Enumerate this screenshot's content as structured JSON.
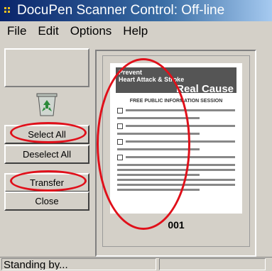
{
  "window": {
    "title": "DocuPen Scanner Control: Off-line"
  },
  "menu": {
    "items": [
      "File",
      "Edit",
      "Options",
      "Help"
    ]
  },
  "buttons": {
    "select_all": "Select All",
    "deselect_all": "Deselect All",
    "transfer": "Transfer",
    "close": "Close"
  },
  "preview": {
    "page_number": "001",
    "document": {
      "heading_line1": "Prevent",
      "heading_line2": "Heart Attack & Stroke",
      "heading_big": "Real Cause",
      "subheading": "FREE PUBLIC INFORMATION SESSION"
    }
  },
  "status": {
    "text": "Standing by..."
  },
  "colors": {
    "annotation_red": "#e0101a",
    "window_bg": "#d4d0c8",
    "title_start": "#0a246a"
  },
  "icons": {
    "app": "docupen-app-icon",
    "recycle": "recycle-bin-icon"
  }
}
